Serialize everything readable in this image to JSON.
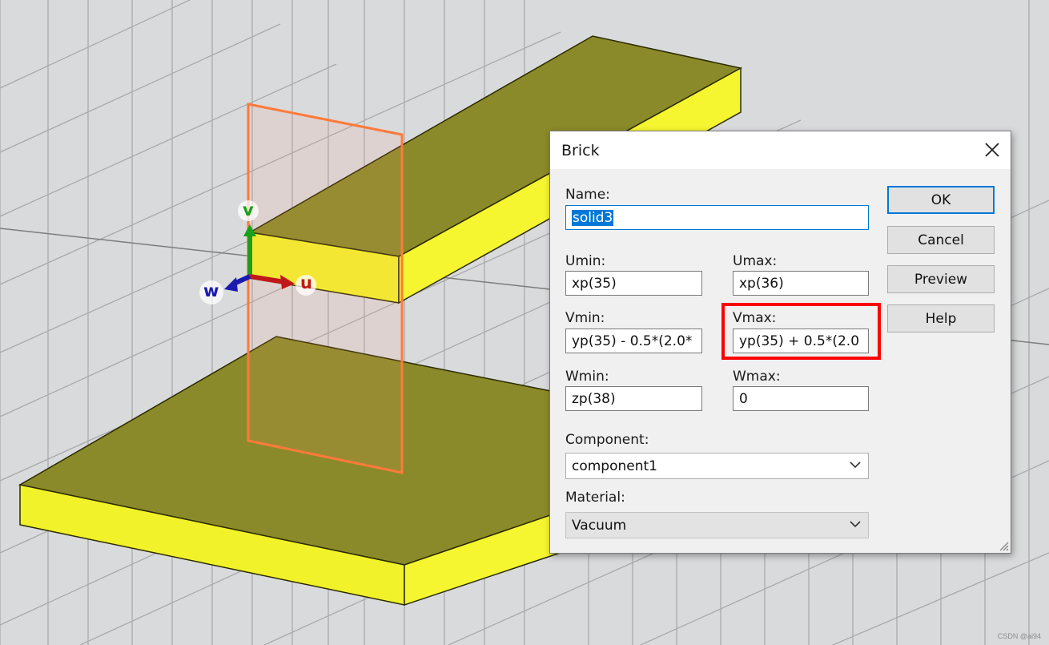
{
  "dialog": {
    "title": "Brick",
    "name_label": "Name:",
    "name_value": "solid3",
    "umin_label": "Umin:",
    "umin_value": "xp(35)",
    "umax_label": "Umax:",
    "umax_value": "xp(36)",
    "vmin_label": "Vmin:",
    "vmin_value": "yp(35) - 0.5*(2.0*",
    "vmax_label": "Vmax:",
    "vmax_value": "yp(35) + 0.5*(2.0",
    "wmin_label": "Wmin:",
    "wmin_value": "zp(38)",
    "wmax_label": "Wmax:",
    "wmax_value": "0",
    "component_label": "Component:",
    "component_value": "component1",
    "material_label": "Material:",
    "material_value": "Vacuum",
    "buttons": {
      "ok": "OK",
      "cancel": "Cancel",
      "preview": "Preview",
      "help": "Help"
    }
  },
  "axes": {
    "v": "v",
    "u": "u",
    "w": "w"
  },
  "watermark": "CSDN @ai94",
  "colors": {
    "solid_top": "#8a8a2a",
    "solid_side": "#f2f22a",
    "highlight": "#ff0000",
    "outline": "#ff7a3a",
    "accent": "#0078d7"
  },
  "icons": {
    "close": "close-icon",
    "dropdown": "chevron-down-icon"
  }
}
